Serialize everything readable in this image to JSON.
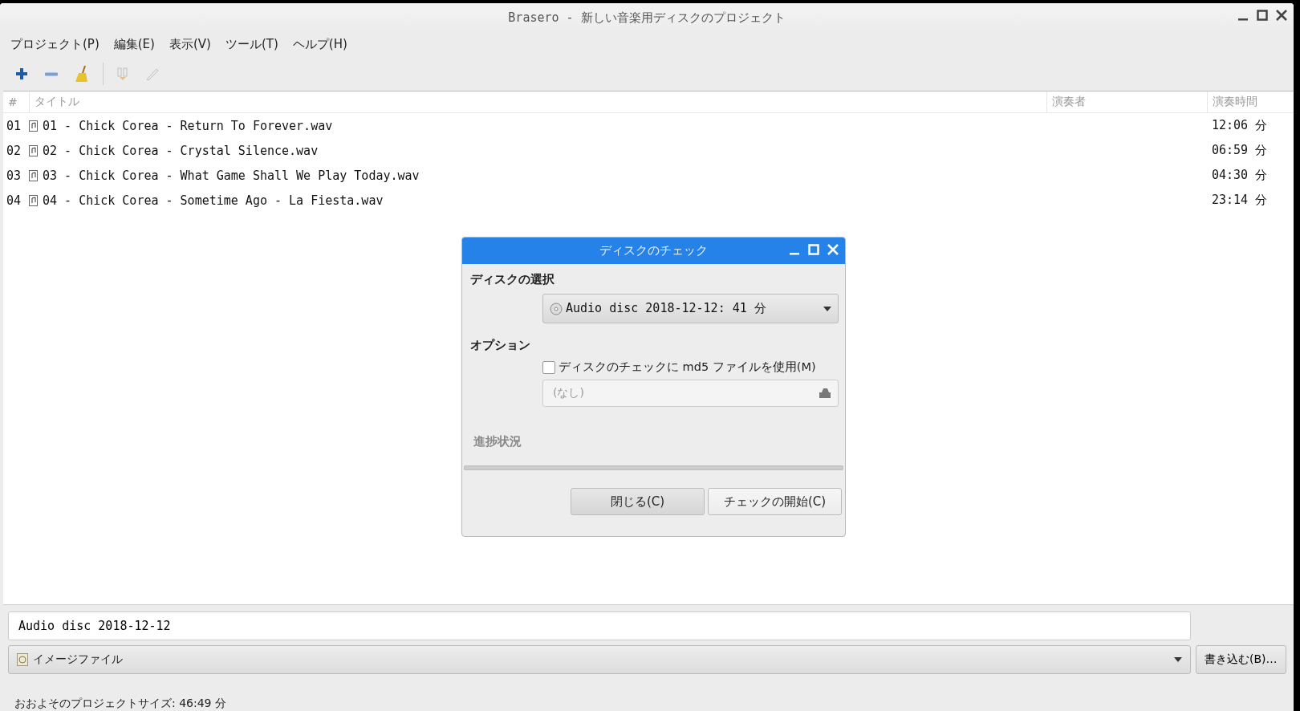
{
  "window": {
    "title": "Brasero - 新しい音楽用ディスクのプロジェクト"
  },
  "menu": [
    "プロジェクト(P)",
    "編集(E)",
    "表示(V)",
    "ツール(T)",
    "ヘルプ(H)"
  ],
  "toolbar": [
    {
      "kind": "add",
      "disabled": false
    },
    {
      "kind": "remove",
      "disabled": false
    },
    {
      "kind": "clean",
      "disabled": false
    },
    {
      "kind": "split",
      "disabled": true
    },
    {
      "kind": "edit",
      "disabled": true
    }
  ],
  "table": {
    "columns": [
      "#",
      "タイトル",
      "演奏者",
      "演奏時間"
    ],
    "rows": [
      {
        "number": "01",
        "title": "01 - Chick Corea - Return To Forever.wav",
        "time": "12:06 分"
      },
      {
        "number": "02",
        "title": "02 - Chick Corea - Crystal Silence.wav",
        "time": "06:59 分"
      },
      {
        "number": "03",
        "title": "03 - Chick Corea - What Game Shall We Play Today.wav",
        "time": "04:30 分"
      },
      {
        "number": "04",
        "title": "04 - Chick Corea - Sometime Ago - La Fiesta.wav",
        "time": "23:14 分"
      }
    ]
  },
  "dialog": {
    "title": "ディスクのチェック",
    "disc_heading": "ディスクの選択",
    "disc_value": "Audio disc 2018-12-12: 41 分",
    "options_heading": "オプション",
    "md5_label": "ディスクのチェックに md5 ファイルを使用(M)",
    "md5_checked": false,
    "file_placeholder": "(なし)",
    "progress_heading": "進捗状況",
    "progress": {
      "level": 0
    },
    "buttons": [
      "閉じる(C)",
      "チェックの開始(C)"
    ]
  },
  "disc_name": "Audio disc 2018-12-12",
  "target": "イメージファイル",
  "burn_button": "書き込む(B)…",
  "status_bar": "おおよそのプロジェクトサイズ: 46:49 分"
}
